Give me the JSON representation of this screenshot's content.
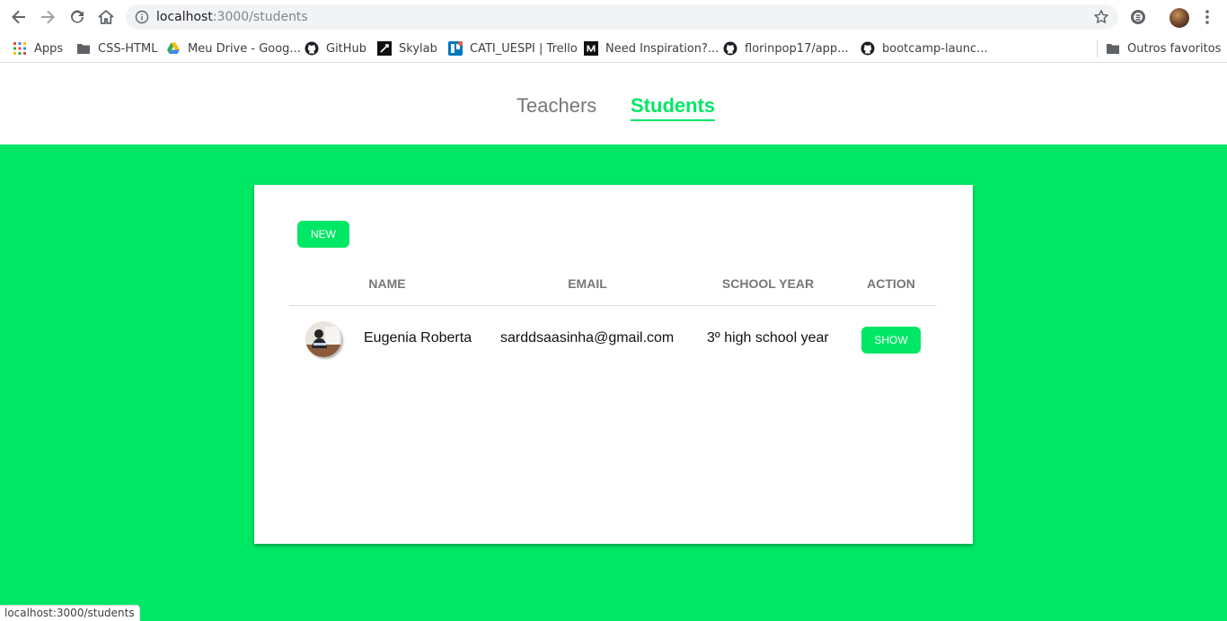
{
  "browser": {
    "url_host": "localhost",
    "url_path": ":3000/students",
    "status_text": "localhost:3000/students"
  },
  "bookmarks": {
    "items": [
      {
        "label": "Apps",
        "icon": "apps-grid-icon"
      },
      {
        "label": "CSS-HTML",
        "icon": "folder-icon"
      },
      {
        "label": "Meu Drive - Goog...",
        "icon": "google-drive-icon"
      },
      {
        "label": "GitHub",
        "icon": "github-icon"
      },
      {
        "label": "Skylab",
        "icon": "skylab-icon"
      },
      {
        "label": "CATI_UESPI | Trello",
        "icon": "trello-icon"
      },
      {
        "label": "Need Inspiration?...",
        "icon": "medium-icon"
      },
      {
        "label": "florinpop17/app...",
        "icon": "github-icon"
      },
      {
        "label": "bootcamp-launc...",
        "icon": "github-icon"
      }
    ],
    "other": "Outros favoritos"
  },
  "nav": {
    "tabs": [
      {
        "label": "Teachers",
        "active": false
      },
      {
        "label": "Students",
        "active": true
      }
    ]
  },
  "card": {
    "new_label": "NEW",
    "columns": [
      "NAME",
      "EMAIL",
      "SCHOOL YEAR",
      "ACTION"
    ],
    "rows": [
      {
        "name": "Eugenia Roberta",
        "email": "sarddsaasinha@gmail.com",
        "school_year": "3º high school year",
        "action": "SHOW"
      }
    ]
  },
  "colors": {
    "accent": "#00e765",
    "muted_text": "#777777"
  }
}
